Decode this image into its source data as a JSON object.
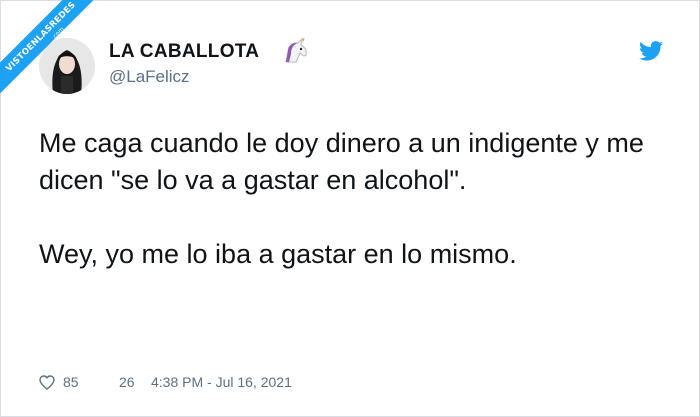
{
  "watermark": {
    "text": "VISTOENLASREDES",
    "sub": ".com",
    "color": "#1da1f2"
  },
  "tweet": {
    "display_name": "LA CABALLOTA",
    "name_emoji": "unicorn-icon",
    "handle": "@LaFelicz",
    "paragraphs": [
      "Me caga cuando le doy dinero a un indigente y me dicen \"se lo va a gastar en alcohol\".",
      "Wey, yo me lo iba a gastar en lo mismo."
    ],
    "likes": "85",
    "retweets": "26",
    "timestamp": "4:38 PM - Jul 16, 2021"
  },
  "colors": {
    "text": "#0f1419",
    "secondary": "#5b7083",
    "twitter_blue": "#1da1f2"
  }
}
